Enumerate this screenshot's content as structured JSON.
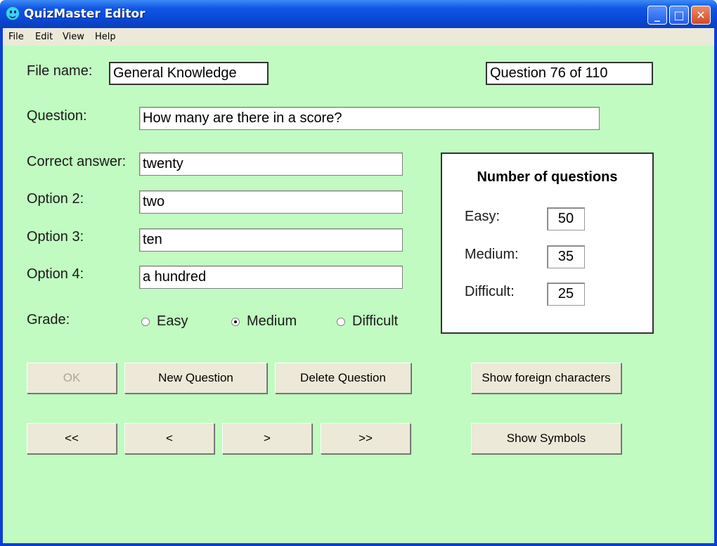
{
  "window": {
    "title": "QuizMaster Editor",
    "controls": {
      "minimize": "_",
      "maximize": "□",
      "close": "✕"
    }
  },
  "menu": [
    "File",
    "Edit",
    "View",
    "Help"
  ],
  "form": {
    "file_name_label": "File name:",
    "file_name": "General Knowledge",
    "question_counter": "Question 76 of 110",
    "question_label": "Question:",
    "question": "How many are there in a score?",
    "correct_label": "Correct answer:",
    "correct": "twenty",
    "option2_label": "Option 2:",
    "option2": "two",
    "option3_label": "Option 3:",
    "option3": "ten",
    "option4_label": "Option 4:",
    "option4": "a hundred",
    "grade_label": "Grade:",
    "grades": [
      {
        "label": "Easy",
        "selected": false
      },
      {
        "label": "Medium",
        "selected": true
      },
      {
        "label": "Difficult",
        "selected": false
      }
    ]
  },
  "stats": {
    "title": "Number of questions",
    "easy_label": "Easy:",
    "easy": "50",
    "medium_label": "Medium:",
    "medium": "35",
    "difficult_label": "Difficult:",
    "difficult": "25"
  },
  "buttons": {
    "ok": "OK",
    "new_question": "New Question",
    "delete_question": "Delete Question",
    "show_foreign": "Show foreign characters",
    "first": "<<",
    "prev": "<",
    "next": ">",
    "last": ">>",
    "show_symbols": "Show Symbols"
  }
}
